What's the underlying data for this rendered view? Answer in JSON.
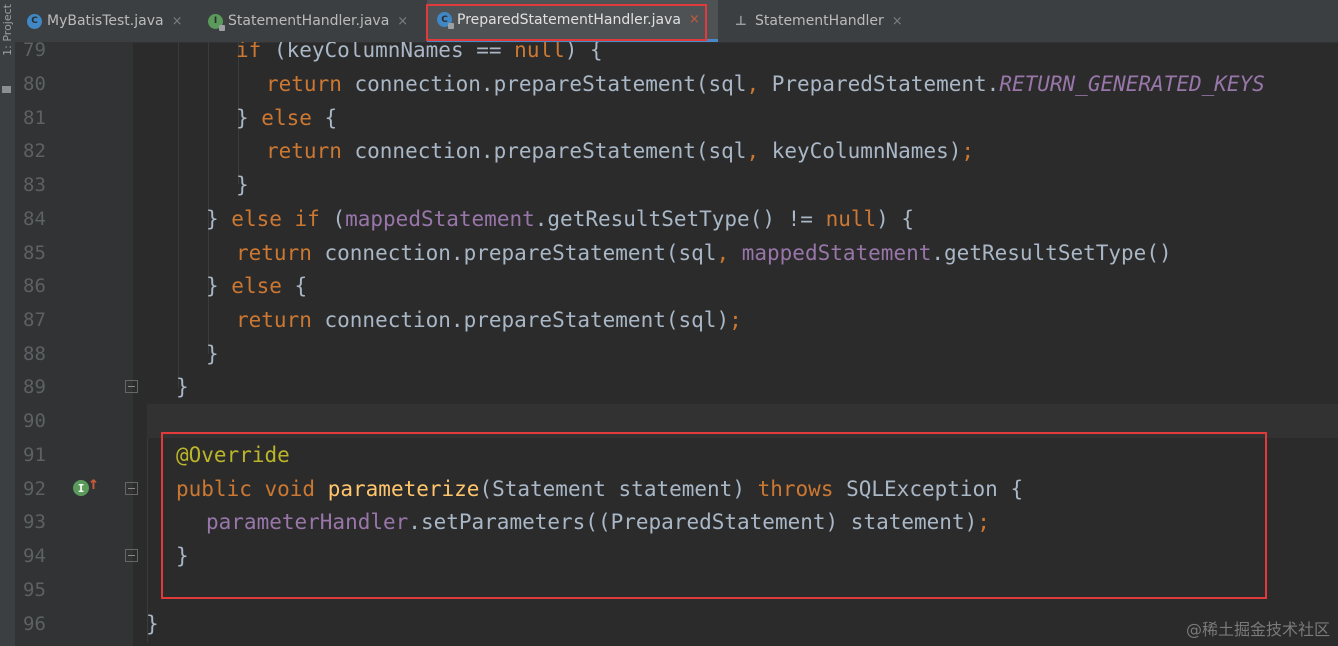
{
  "sidebar": {
    "project_label": "1: Project"
  },
  "tabs": [
    {
      "label": "MyBatisTest.java",
      "icon": "class-icon",
      "closable": true
    },
    {
      "label": "StatementHandler.java",
      "icon": "interface-icon",
      "closable": true
    },
    {
      "label": "PreparedStatementHandler.java",
      "icon": "class-icon",
      "closable": true,
      "active": true
    },
    {
      "label": "StatementHandler",
      "icon": "structure-icon",
      "closable": true
    }
  ],
  "close_glyph": "×",
  "gutter": {
    "line_numbers": [
      "79",
      "80",
      "81",
      "82",
      "83",
      "84",
      "85",
      "86",
      "87",
      "88",
      "89",
      "90",
      "91",
      "92",
      "93",
      "94",
      "95",
      "96"
    ],
    "override_marker": "I"
  },
  "code_lines": {
    "l79": {
      "a": "if",
      "b": " (keyColumnNames == ",
      "c": "null",
      "d": ") {"
    },
    "l80": {
      "a": "return",
      "b": " connection.prepareStatement(sql",
      "c": ",",
      "d": " PreparedStatement.",
      "e": "RETURN_GENERATED_KEYS"
    },
    "l81": {
      "a": "} ",
      "b": "else",
      "c": " {"
    },
    "l82": {
      "a": "return",
      "b": " connection.prepareStatement(sql",
      "c": ",",
      "d": " keyColumnNames)",
      "e": ";"
    },
    "l83": {
      "a": "}"
    },
    "l84": {
      "a": "} ",
      "b": "else if",
      "c": " (",
      "d": "mappedStatement",
      "e": ".getResultSetType() != ",
      "f": "null",
      "g": ") {"
    },
    "l85": {
      "a": "return",
      "b": " connection.prepareStatement(sql",
      "c": ",",
      "d": " mappedStatement",
      "e": ".getResultSetType()"
    },
    "l86": {
      "a": "} ",
      "b": "else",
      "c": " {"
    },
    "l87": {
      "a": "return",
      "b": " connection.prepareStatement(sql)",
      "c": ";"
    },
    "l88": {
      "a": "}"
    },
    "l89": {
      "a": "}"
    },
    "l91": {
      "a": "@Override"
    },
    "l92": {
      "a": "public void",
      "b": " ",
      "c": "parameterize",
      "d": "(Statement statement) ",
      "e": "throws",
      "f": " SQLException {"
    },
    "l93": {
      "a": "parameterHandler",
      "b": ".setParameters((PreparedStatement) statement)",
      "c": ";"
    },
    "l94": {
      "a": "}"
    },
    "l96": {
      "a": "}"
    }
  },
  "watermark": "@稀土掘金技术社区",
  "colors": {
    "editor_bg": "#2b2b2b",
    "keyword": "#cc7832",
    "field": "#9876aa",
    "annotation": "#bbb529",
    "method_decl": "#ffc66d",
    "plain": "#a9b7c6",
    "highlight_box": "#e03a3a"
  }
}
